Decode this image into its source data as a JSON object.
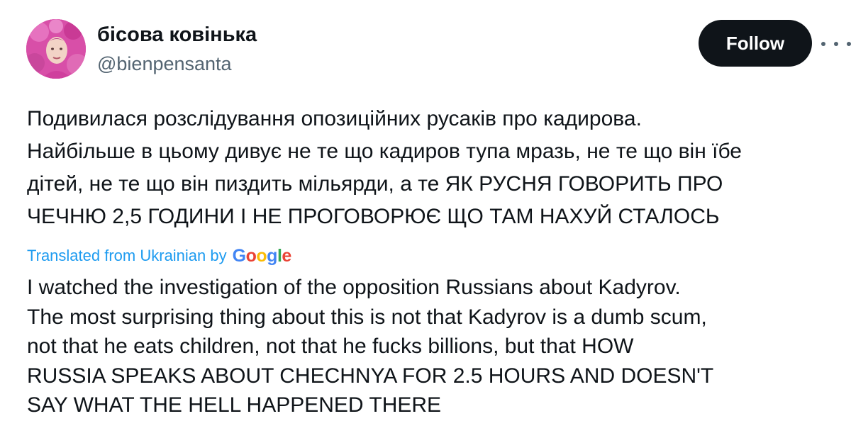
{
  "author": {
    "display_name": "бісова ковінька",
    "handle": "@bienpensanta",
    "avatar": "avatar-photo-pink-costume"
  },
  "actions": {
    "follow_label": "Follow",
    "more_icon": "more-options-icon"
  },
  "tweet": {
    "original_lines": [
      "Подивилася розслідування опозиційних русаків про кадирова.",
      "Найбільше в цьому дивує не те що кадиров тупа мразь, не те що він їбе",
      "дітей, не те що він пиздить мільярди, а те ЯК РУСНЯ ГОВОРИТЬ ПРО",
      "ЧЕЧНЮ 2,5 ГОДИНИ І НЕ ПРОГОВОРЮЄ ЩО ТАМ НАХУЙ СТАЛОСЬ"
    ],
    "translation_label": "Translated from Ukrainian by",
    "translation_provider": "Google",
    "translated_lines": [
      "I watched the investigation of the opposition Russians about Kadyrov.",
      "The most surprising thing about this is not that Kadyrov is a dumb scum,",
      "not that he eats children, not that he fucks billions, but that HOW",
      "RUSSIA SPEAKS ABOUT CHECHNYA FOR 2.5 HOURS AND DOESN'T",
      "SAY WHAT THE HELL HAPPENED THERE"
    ]
  },
  "colors": {
    "text": "#0f1419",
    "secondary": "#536471",
    "link": "#1d9bf0",
    "button_bg": "#0f1419",
    "button_text": "#ffffff"
  }
}
